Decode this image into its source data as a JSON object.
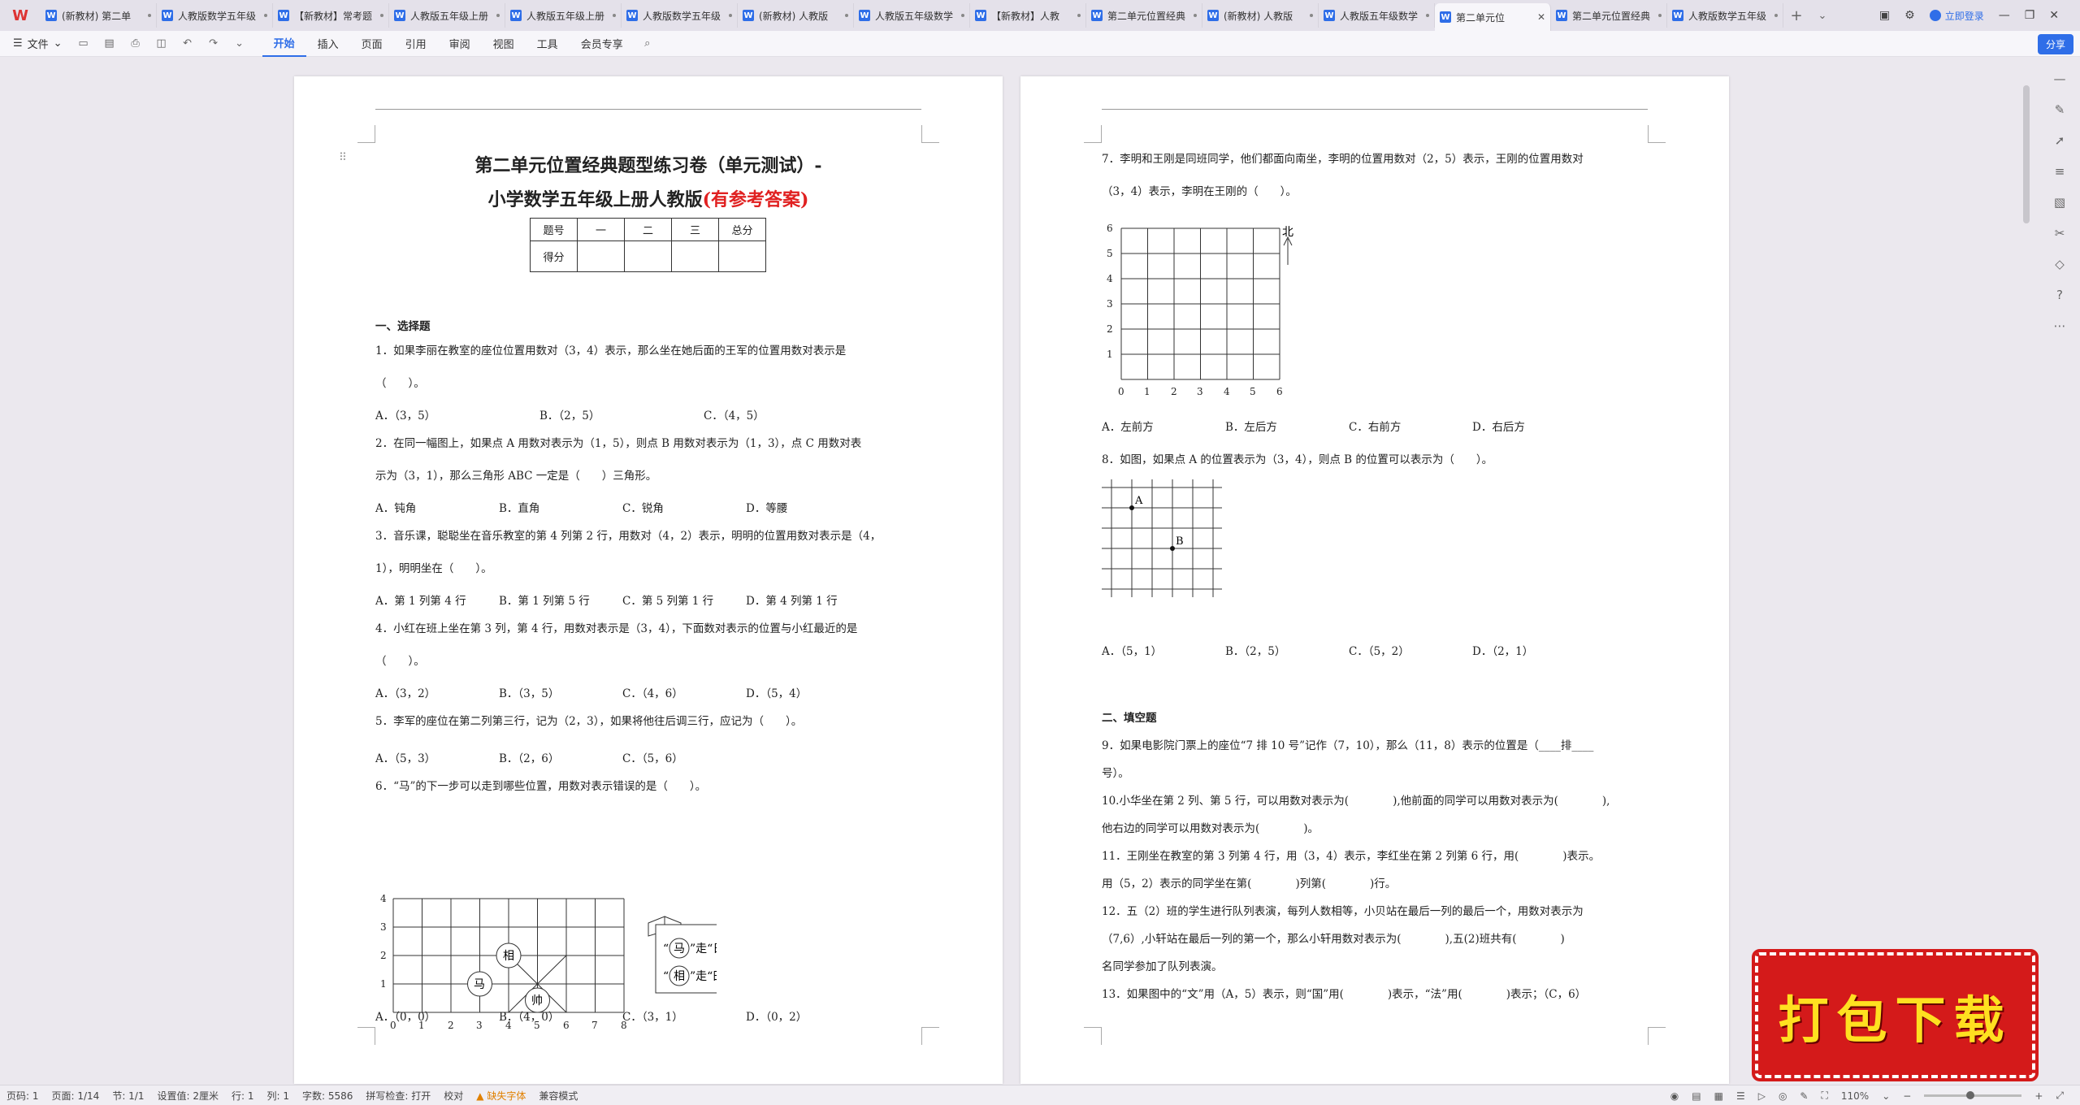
{
  "tabs": [
    {
      "label": "(新教材) 第二单"
    },
    {
      "label": "人教版数学五年级"
    },
    {
      "label": "【新教材】常考题"
    },
    {
      "label": "人教版五年级上册"
    },
    {
      "label": "人教版五年级上册"
    },
    {
      "label": "人教版数学五年级"
    },
    {
      "label": "(新教材) 人教版"
    },
    {
      "label": "人教版五年级数学"
    },
    {
      "label": "【新教材】人教"
    },
    {
      "label": "第二单元位置经典"
    },
    {
      "label": "(新教材) 人教版"
    },
    {
      "label": "人教版五年级数学"
    },
    {
      "label": "第二单元位",
      "active": true
    },
    {
      "label": "第二单元位置经典"
    },
    {
      "label": "人教版数学五年级"
    }
  ],
  "login": "立即登录",
  "ribbon": {
    "file": "文件",
    "tabs": [
      "开始",
      "插入",
      "页面",
      "引用",
      "审阅",
      "视图",
      "工具",
      "会员专享"
    ],
    "share": "分享"
  },
  "doc": {
    "title1": "第二单元位置经典题型练习卷（单元测试）-",
    "title2a": "小学数学五年级上册人教版",
    "title2b": "(有参考答案)",
    "table": {
      "header": [
        "题号",
        "一",
        "二",
        "三",
        "总分"
      ],
      "row2": "得分"
    },
    "sec1": "一、选择题",
    "q1a": "1．如果李丽在教室的座位位置用数对（3，4）表示，那么坐在她后面的王军的位置用数对表示是",
    "q1b": "（　　）。",
    "q1opts": [
      "A．（3，5）",
      "B．（2，5）",
      "C．（4，5）"
    ],
    "q2a": "2．在同一幅图上，如果点 A 用数对表示为（1，5），则点 B 用数对表示为（1，3），点 C 用数对表",
    "q2b": "示为（3，1），那么三角形 ABC 一定是（　　）三角形。",
    "q2opts": [
      "A．钝角",
      "B．直角",
      "C．锐角",
      "D．等腰"
    ],
    "q3a": "3．音乐课，聪聪坐在音乐教室的第 4 列第 2 行，用数对（4，2）表示，明明的位置用数对表示是（4，",
    "q3b": "1），明明坐在（　　）。",
    "q3opts": [
      "A．第 1 列第 4 行",
      "B．第 1 列第 5 行",
      "C．第 5 列第 1 行",
      "D．第 4 列第 1 行"
    ],
    "q4a": "4．小红在班上坐在第 3 列，第 4 行，用数对表示是（3，4），下面数对表示的位置与小红最近的是",
    "q4b": "（　　）。",
    "q4opts": [
      "A．（3，2）",
      "B．（3，5）",
      "C．（4，6）",
      "D．（5，4）"
    ],
    "q5": "5．李军的座位在第二列第三行，记为（2，3），如果将他往后调三行，应记为（　　）。",
    "q5opts": [
      "A．（5，3）",
      "B．（2，6）",
      "C．（5，6）"
    ],
    "q6": "6．“马”的下一步可以走到哪些位置，用数对表示错误的是（　　）。",
    "q6fig": {
      "horse": "马",
      "xiang": "相",
      "shuai": "帅",
      "rule1a": "“",
      "rule1b": "”走“日”，",
      "rule2a": "“",
      "rule2b": "”走“田”。"
    },
    "q6opts": [
      "A．（0，0）",
      "B．（4，0）",
      "C．（3，1）",
      "D．（0，2）"
    ],
    "q7a": "7．李明和王刚是同班同学，他们都面向南坐，李明的位置用数对（2，5）表示，王刚的位置用数对",
    "q7b": "（3，4）表示，李明在王刚的（　　）。",
    "q7north": "北",
    "q7opts": [
      "A．左前方",
      "B．左后方",
      "C．右前方",
      "D．右后方"
    ],
    "q8": "8．如图，如果点 A 的位置表示为（3，4），则点 B 的位置可以表示为（　　）。",
    "q8labels": [
      "A",
      "B"
    ],
    "q8opts": [
      "A．（5，1）",
      "B．（2，5）",
      "C．（5，2）",
      "D．（2，1）"
    ],
    "sec2": "二、填空题",
    "q9a": "9．如果电影院门票上的座位“7 排 10 号”记作（7，10），那么（11，8）表示的位置是（____排____",
    "q9b": "号）。",
    "q10a": "10.小华坐在第 2 列、第 5 行，可以用数对表示为(　　　　),他前面的同学可以用数对表示为(　　　　),",
    "q10b": "他右边的同学可以用数对表示为(　　　　)。",
    "q11a": "11．王刚坐在教室的第 3 列第 4 行，用（3，4）表示，李红坐在第 2 列第 6 行，用(　　　　)表示。",
    "q11b": "用（5，2）表示的同学坐在第(　　　　)列第(　　　　)行。",
    "q12a": "12．五（2）班的学生进行队列表演，每列人数相等，小贝站在最后一列的最后一个，用数对表示为",
    "q12b": "（7,6）,小轩站在最后一列的第一个，那么小轩用数对表示为(　　　　),五(2)班共有(　　　　)",
    "q12c": "名同学参加了队列表演。",
    "q13": "13．如果图中的“文”用（A，5）表示，则“国”用(　　　　)表示，“法”用(　　　　)表示；（C，6）"
  },
  "status": {
    "page": "页码: 1",
    "pages": "页面: 1/14",
    "section": "节: 1/1",
    "setting": "设置值: 2厘米",
    "row": "行: 1",
    "col": "列: 1",
    "words": "字数: 5586",
    "spell": "拼写检查: 打开",
    "proof": "校对",
    "missingfont": "缺失字体",
    "compat": "兼容模式",
    "zoom": "110%"
  },
  "download": "打包下载",
  "colors": {
    "accent": "#2f6ee8",
    "red": "#e02020",
    "badge": "#d41a1a",
    "badgeText": "#ffe020"
  }
}
